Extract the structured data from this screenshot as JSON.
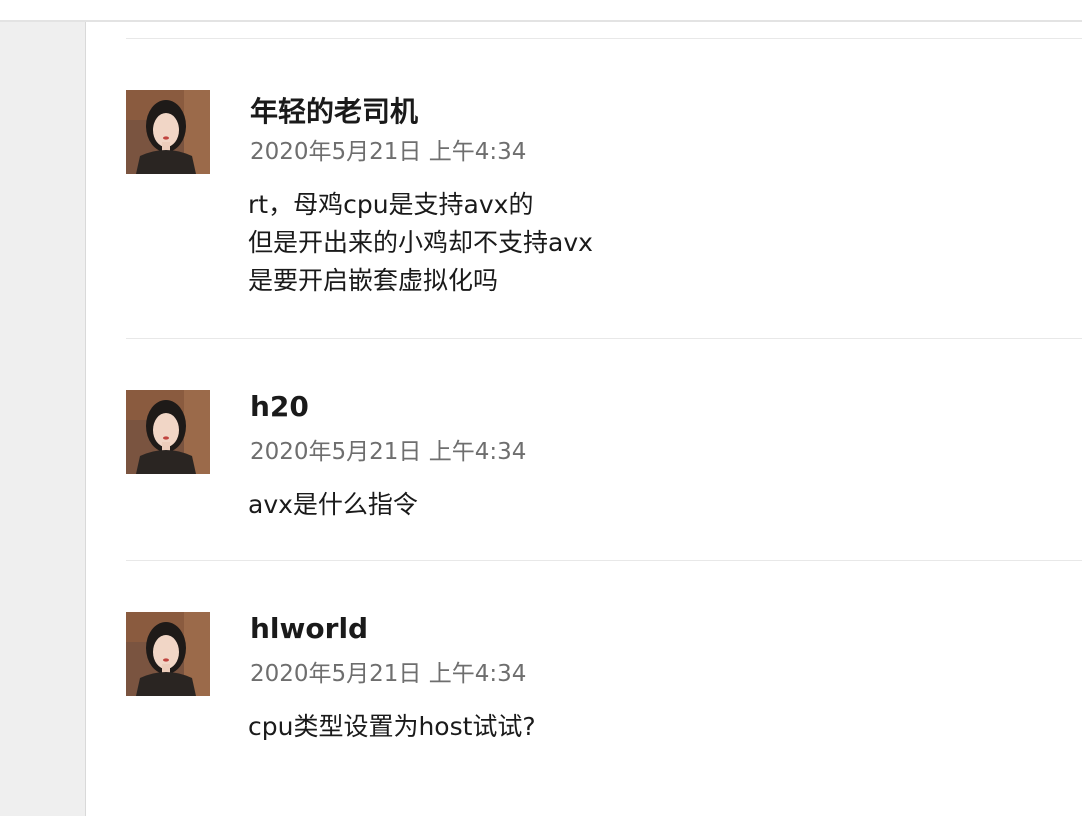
{
  "posts": [
    {
      "author": "年轻的老司机",
      "time": "2020年5月21日 上午4:34",
      "lines": [
        "rt，母鸡cpu是支持avx的",
        "但是开出来的小鸡却不支持avx",
        "是要开启嵌套虚拟化吗"
      ]
    },
    {
      "author": "h20",
      "time": "2020年5月21日 上午4:34",
      "lines": [
        "avx是什么指令"
      ]
    },
    {
      "author": "hlworld",
      "time": "2020年5月21日 上午4:34",
      "lines": [
        "cpu类型设置为host试试?"
      ]
    }
  ]
}
